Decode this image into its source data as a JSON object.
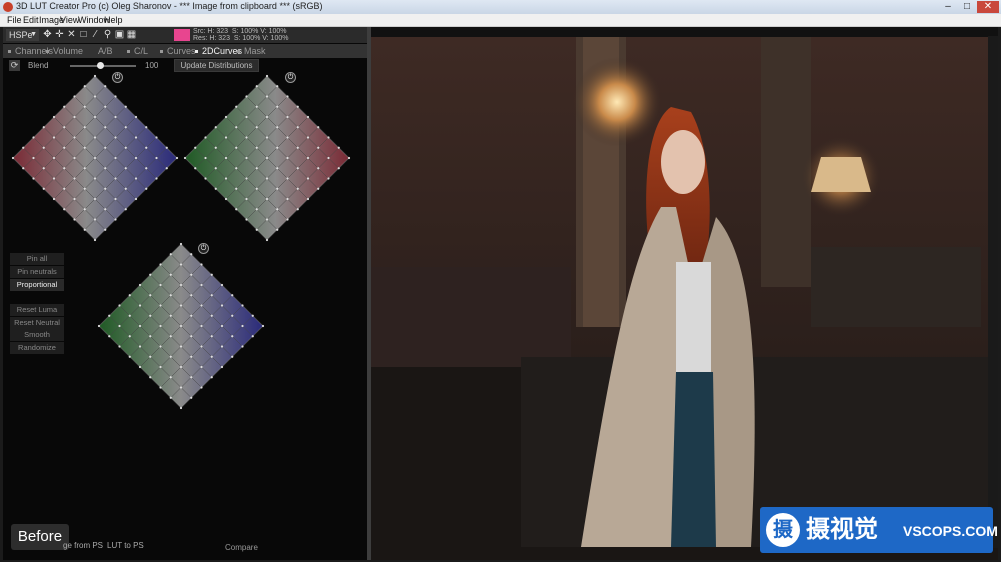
{
  "window": {
    "title": "3D LUT Creator Pro (c) Oleg Sharonov - *** Image from clipboard *** (sRGB)",
    "controls": {
      "minimize": "–",
      "maximize": "□",
      "close": "✕"
    }
  },
  "menu": [
    "File",
    "Edit",
    "Image",
    "View",
    "Window",
    "Help"
  ],
  "toolbar": {
    "color_model": "HSPe",
    "swatch_color": "#e8458f",
    "readout_line1": "Src: H: 323  S: 100% V: 100%",
    "readout_line2": "Res: H: 323  S: 100% V: 100%",
    "icons": [
      "move-icon",
      "crosshair-icon",
      "cross-icon",
      "square-icon",
      "eyedropper-icon",
      "magnifier-icon",
      "frame-icon",
      "grid-icon"
    ]
  },
  "tabs": [
    "Channels",
    "Volume",
    "A/B",
    "C/L",
    "Curves",
    "2DCurves",
    "Mask"
  ],
  "active_tab": "2DCurves",
  "blend": {
    "label": "Blend",
    "value": "100",
    "fraction": 0.46
  },
  "update_button": "Update Distributions",
  "side_buttons": {
    "pin_all": "Pin all",
    "pin_neutrals": "Pin neutrals",
    "proportional": "Proportional",
    "reset_luma": "Reset Luma",
    "reset_neutral": "Reset Neutral",
    "smooth": "Smooth",
    "randomize": "Randomize"
  },
  "bottom": {
    "before": "Before",
    "from_ps": "ge from PS",
    "lut_to_ps": "LUT to PS",
    "compare": "Compare"
  },
  "power_icon": "⏻",
  "watermark": {
    "cn": "摄视觉",
    "en": "VSCOPS.COM",
    "glyph": "摄"
  },
  "colors": {
    "panel_bg": "#080808",
    "accent_pink": "#e8458f",
    "logo_blue": "#1e68c6"
  }
}
